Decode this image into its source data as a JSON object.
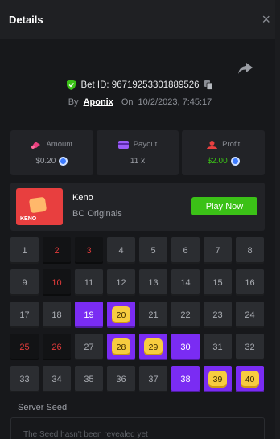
{
  "header": {
    "title": "Details",
    "close_icon": "×"
  },
  "bet": {
    "id_label": "Bet ID: 96719253301889526",
    "by_label": "By",
    "username": "Aponix",
    "on_label": "On",
    "datetime": "10/2/2023, 7:45:17"
  },
  "stats": [
    {
      "icon": "amount-icon",
      "label": "Amount",
      "value": "$0.20",
      "coin": true
    },
    {
      "icon": "payout-icon",
      "label": "Payout",
      "value": "11 x",
      "coin": false
    },
    {
      "icon": "profit-icon",
      "label": "Profit",
      "value": "$2.00",
      "coin": true
    }
  ],
  "game": {
    "thumbnail_tag": "KENO",
    "name": "Keno",
    "provider": "BC Originals",
    "play_label": "Play Now"
  },
  "grid": [
    {
      "n": "1",
      "s": "normal"
    },
    {
      "n": "2",
      "s": "miss"
    },
    {
      "n": "3",
      "s": "miss"
    },
    {
      "n": "4",
      "s": "normal"
    },
    {
      "n": "5",
      "s": "normal"
    },
    {
      "n": "6",
      "s": "normal"
    },
    {
      "n": "7",
      "s": "normal"
    },
    {
      "n": "8",
      "s": "normal"
    },
    {
      "n": "9",
      "s": "normal"
    },
    {
      "n": "10",
      "s": "miss"
    },
    {
      "n": "11",
      "s": "normal"
    },
    {
      "n": "12",
      "s": "normal"
    },
    {
      "n": "13",
      "s": "normal"
    },
    {
      "n": "14",
      "s": "normal"
    },
    {
      "n": "15",
      "s": "normal"
    },
    {
      "n": "16",
      "s": "normal"
    },
    {
      "n": "17",
      "s": "normal"
    },
    {
      "n": "18",
      "s": "normal"
    },
    {
      "n": "19",
      "s": "hit"
    },
    {
      "n": "20",
      "s": "gold"
    },
    {
      "n": "21",
      "s": "normal"
    },
    {
      "n": "22",
      "s": "normal"
    },
    {
      "n": "23",
      "s": "normal"
    },
    {
      "n": "24",
      "s": "normal"
    },
    {
      "n": "25",
      "s": "miss"
    },
    {
      "n": "26",
      "s": "miss"
    },
    {
      "n": "27",
      "s": "normal"
    },
    {
      "n": "28",
      "s": "gold"
    },
    {
      "n": "29",
      "s": "gold"
    },
    {
      "n": "30",
      "s": "hit"
    },
    {
      "n": "31",
      "s": "normal"
    },
    {
      "n": "32",
      "s": "normal"
    },
    {
      "n": "33",
      "s": "normal"
    },
    {
      "n": "34",
      "s": "normal"
    },
    {
      "n": "35",
      "s": "normal"
    },
    {
      "n": "36",
      "s": "normal"
    },
    {
      "n": "37",
      "s": "normal"
    },
    {
      "n": "38",
      "s": "hit"
    },
    {
      "n": "39",
      "s": "gold"
    },
    {
      "n": "40",
      "s": "gold"
    }
  ],
  "seed": {
    "label": "Server Seed",
    "text": "The Seed hasn't been revealed yet"
  },
  "colors": {
    "accent_green": "#3bc117",
    "hit_purple": "#7a2cf3",
    "gold_tile": "#f7cc3f",
    "miss_red": "#e23b3b"
  }
}
